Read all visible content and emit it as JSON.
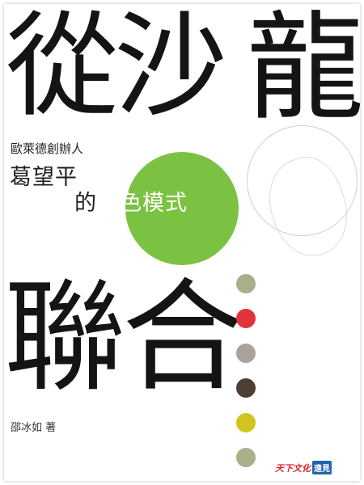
{
  "cover": {
    "title_line1": "從沙",
    "title_line2": "聯合",
    "title_right": "龍到國",
    "founder_label": "歐萊德創辦人",
    "founder_name": "葛望平",
    "subtitle_lead": "的",
    "subtitle_highlight": "綠色模式",
    "author": "邵冰如 著",
    "publisher_logo_a": "天下文化",
    "publisher_logo_b": "遠見"
  },
  "colors": {
    "circle_green": "#7cc242",
    "dots": [
      "#a8b08a",
      "#e0343c",
      "#a9a39c",
      "#4d3f36",
      "#d2c41e",
      "#a8b08a"
    ]
  }
}
